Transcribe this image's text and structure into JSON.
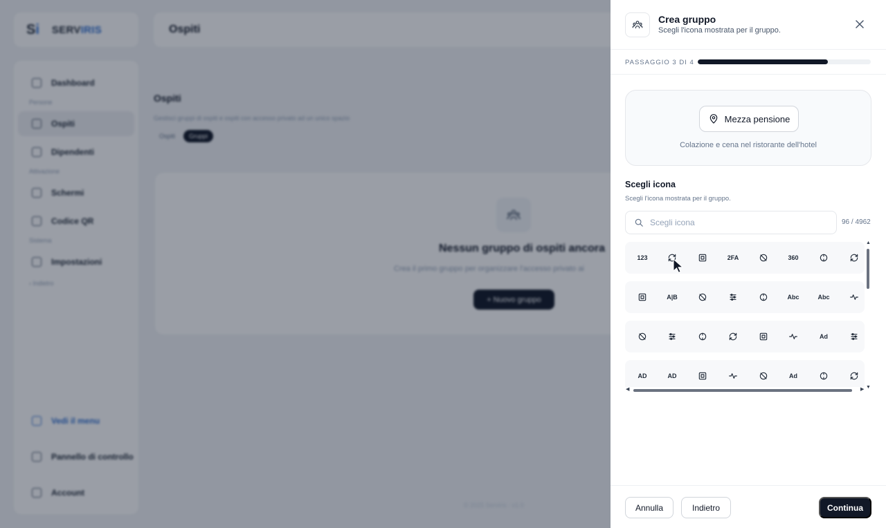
{
  "background": {
    "logo": {
      "mark": "S",
      "mark_accent": "i",
      "name": "SERV",
      "name_accent": "IRIS"
    },
    "topbar_title": "Ospiti",
    "sidebar": {
      "items": [
        {
          "label": "Dashboard",
          "icon": "grid-icon"
        },
        {
          "section": "Persone"
        },
        {
          "label": "Ospiti",
          "icon": "users-icon",
          "active": true
        },
        {
          "label": "Dipendenti",
          "icon": "briefcase-icon"
        },
        {
          "section": "Attivazione"
        },
        {
          "label": "Schermi",
          "icon": "monitor-icon"
        },
        {
          "label": "Codice QR",
          "icon": "qr-icon"
        },
        {
          "section": "Sistema"
        },
        {
          "label": "Impostazioni",
          "icon": "gear-icon"
        }
      ],
      "indicator": "‹ Indietro",
      "bottom": [
        {
          "label": "Vedi il menu",
          "icon": "external-link-icon"
        },
        {
          "label": "Pannello di controllo",
          "icon": "sliders-icon"
        },
        {
          "label": "Account",
          "icon": "user-icon"
        }
      ]
    },
    "page_title": "Ospiti",
    "page_subtitle": "Gestisci gruppi di ospiti e ospiti con accesso privato ad un unico spazio",
    "tabs": [
      "Ospiti",
      "Gruppi"
    ],
    "empty": {
      "title": "Nessun gruppo di ospiti ancora",
      "subtitle": "Crea il primo gruppo per organizzare l'accesso privato ai",
      "button": "+ Nuovo gruppo"
    },
    "footer_ghost": "© 2025 Serviris   ·   v1.0"
  },
  "drawer": {
    "title": "Crea gruppo",
    "subtitle": "Scegli l'icona mostrata per il gruppo.",
    "step_label": "PASSAGGIO 3 DI 4",
    "progress": 0.75,
    "preview": {
      "name": "Mezza pensione",
      "icon": "map-pin-icon",
      "description": "Colazione e cena nel ristorante dell'hotel"
    },
    "icon_section": {
      "title": "Scegli icona",
      "subtitle": "Scegli l'icona mostrata per il gruppo.",
      "search_placeholder": "Scegli icona",
      "search_value": "",
      "count": "96 / 4962"
    },
    "icon_rows": [
      [
        {
          "name": "123-icon",
          "text": "123"
        },
        {
          "name": "rotate-clockwise-icon"
        },
        {
          "name": "24-hours-icon"
        },
        {
          "name": "2fa-icon",
          "text": "2FA"
        },
        {
          "name": "link-icon"
        },
        {
          "name": "360-view-icon",
          "text": "360"
        },
        {
          "name": "3d-rotation-icon"
        },
        {
          "name": "rotate-off-icon"
        }
      ],
      [
        {
          "name": "accessibility-icon"
        },
        {
          "name": "a-b-icon",
          "text": "A|B"
        },
        {
          "name": "refresh-icon"
        },
        {
          "name": "abacus-icon"
        },
        {
          "name": "abacus-off-icon"
        },
        {
          "name": "abc-icon",
          "text": "Abc"
        },
        {
          "name": "abc-off-icon",
          "text": "Abc"
        },
        {
          "name": "accessible-icon"
        }
      ],
      [
        {
          "name": "accessible-off-icon"
        },
        {
          "name": "accessible-filled-icon"
        },
        {
          "name": "broadcast-icon"
        },
        {
          "name": "broadcast-off-icon"
        },
        {
          "name": "activity-icon"
        },
        {
          "name": "activity-heartbeat-icon"
        },
        {
          "name": "ad-icon",
          "text": "Ad"
        },
        {
          "name": "ad-2-icon"
        }
      ],
      [
        {
          "name": "ad-circle-icon",
          "text": "AD"
        },
        {
          "name": "ad-circle-filled-icon",
          "text": "AD"
        },
        {
          "name": "ad-circle-off-icon"
        },
        {
          "name": "ad-off-icon"
        },
        {
          "name": "ad-off-2-icon"
        },
        {
          "name": "ad-filled-icon",
          "text": "Ad"
        },
        {
          "name": "adjustments-icon"
        },
        {
          "name": "adjustments-alt-icon"
        }
      ]
    ],
    "buttons": {
      "cancel": "Annulla",
      "back": "Indietro",
      "continue": "Continua"
    }
  }
}
